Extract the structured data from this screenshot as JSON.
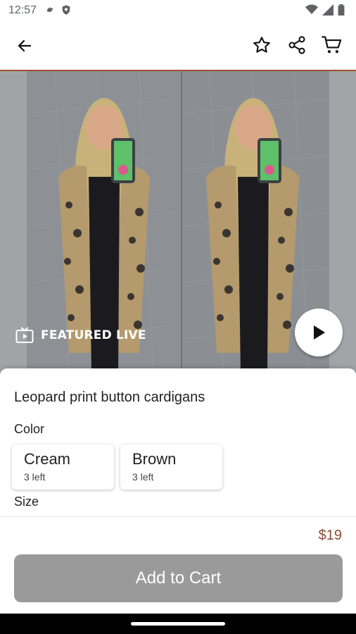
{
  "status_bar": {
    "time": "12:57",
    "icons": [
      "settings-icon",
      "shield-icon",
      "wifi-icon",
      "signal-icon",
      "battery-icon"
    ]
  },
  "header": {
    "back_icon": "arrow-left-icon",
    "actions": [
      "star-icon",
      "share-icon",
      "cart-icon"
    ]
  },
  "hero": {
    "badge_text": "FEATURED LIVE",
    "badge_icon": "tv-play-icon",
    "play_icon": "play-icon"
  },
  "product": {
    "title": "Leopard print button cardigans",
    "color_label": "Color",
    "colors": [
      {
        "name": "Cream",
        "stock": "3 left"
      },
      {
        "name": "Brown",
        "stock": "3 left"
      }
    ],
    "size_label": "Size",
    "price": "$19",
    "add_to_cart_label": "Add to Cart"
  },
  "colors": {
    "accent_border": "#a0522d",
    "price_color": "#8b4a3a",
    "button_bg": "#9a9a9a"
  }
}
